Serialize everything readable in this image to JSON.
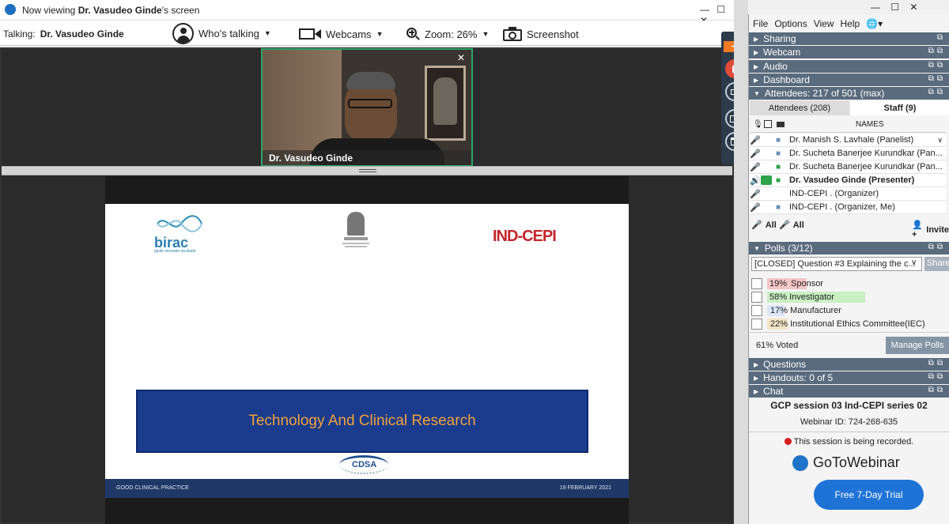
{
  "viewer": {
    "title_prefix": "Now viewing ",
    "title_name": "Dr. Vasudeo Ginde",
    "title_suffix": "'s screen",
    "talking_label": "Talking:",
    "talking_name": "Dr. Vasudeo Ginde",
    "whos_talking": "Who's talking",
    "webcams": "Webcams",
    "zoom": "Zoom: 26%",
    "screenshot": "Screenshot",
    "window_controls": "— ☐ ✕"
  },
  "webcam": {
    "name": "Dr. Vasudeo Ginde",
    "close": "✕"
  },
  "slide": {
    "logo_left": "birac",
    "logo_left_tagline": "ignite innovate incubate",
    "logo_right": "IND-CEPI",
    "title": "Technology And Clinical Research",
    "bottom_logo": "CDSA",
    "footer_left": "GOOD CLINICAL PRACTICE",
    "footer_right": "19 FEBRUARY 2021"
  },
  "panel": {
    "window_controls": "— ☐ ✕",
    "menu": [
      "File",
      "Options",
      "View",
      "Help"
    ],
    "sections": {
      "sharing": "Sharing",
      "webcam": "Webcam",
      "audio": "Audio",
      "dashboard": "Dashboard",
      "attendees": "Attendees:  217 of 501 (max)",
      "polls": "Polls (3/12)",
      "questions": "Questions",
      "handouts": "Handouts: 0 of 5",
      "chat": "Chat"
    },
    "attendee_tabs": {
      "attendees": "Attendees (208)",
      "staff": "Staff (9)"
    },
    "names_header": "NAMES",
    "staff": [
      {
        "name": "Dr. Manish S. Lavhale  (Panelist)",
        "bold": false
      },
      {
        "name": "Dr. Sucheta Banerjee Kurundkar (Pan...",
        "bold": false
      },
      {
        "name": "Dr. Sucheta Banerjee Kurundkar (Pan...",
        "bold": false
      },
      {
        "name": "Dr. Vasudeo Ginde (Presenter)",
        "bold": true
      },
      {
        "name": "IND-CEPI . (Organizer)",
        "bold": false
      },
      {
        "name": "IND-CEPI . (Organizer, Me)",
        "bold": false
      }
    ],
    "mute_all": "All",
    "unmute_all": "All",
    "invite": "Invite",
    "poll_question": "[CLOSED] Question #3  Explaining the c...",
    "share_button": "Share",
    "poll_options": [
      {
        "pct": "19%",
        "label": "Sponsor",
        "value": 19,
        "color": "#f4c6c6"
      },
      {
        "pct": "58%",
        "label": "Investigator",
        "value": 58,
        "color": "#c9efc2"
      },
      {
        "pct": "17%",
        "label": "Manufacturer",
        "value": 17,
        "color": "#dbe6f6"
      },
      {
        "pct": "22%",
        "label": "Institutional Ethics Committee(IEC)",
        "value": 22,
        "color": "#f3e4c6"
      }
    ],
    "voted": "61% Voted",
    "manage_polls": "Manage Polls",
    "session_title": "GCP session 03 Ind-CEPI series 02",
    "webinar_id": "Webinar ID: 724-268-635",
    "recording": "This session is being recorded.",
    "brand": "GoToWebinar",
    "trial_button": "Free 7-Day Trial"
  }
}
